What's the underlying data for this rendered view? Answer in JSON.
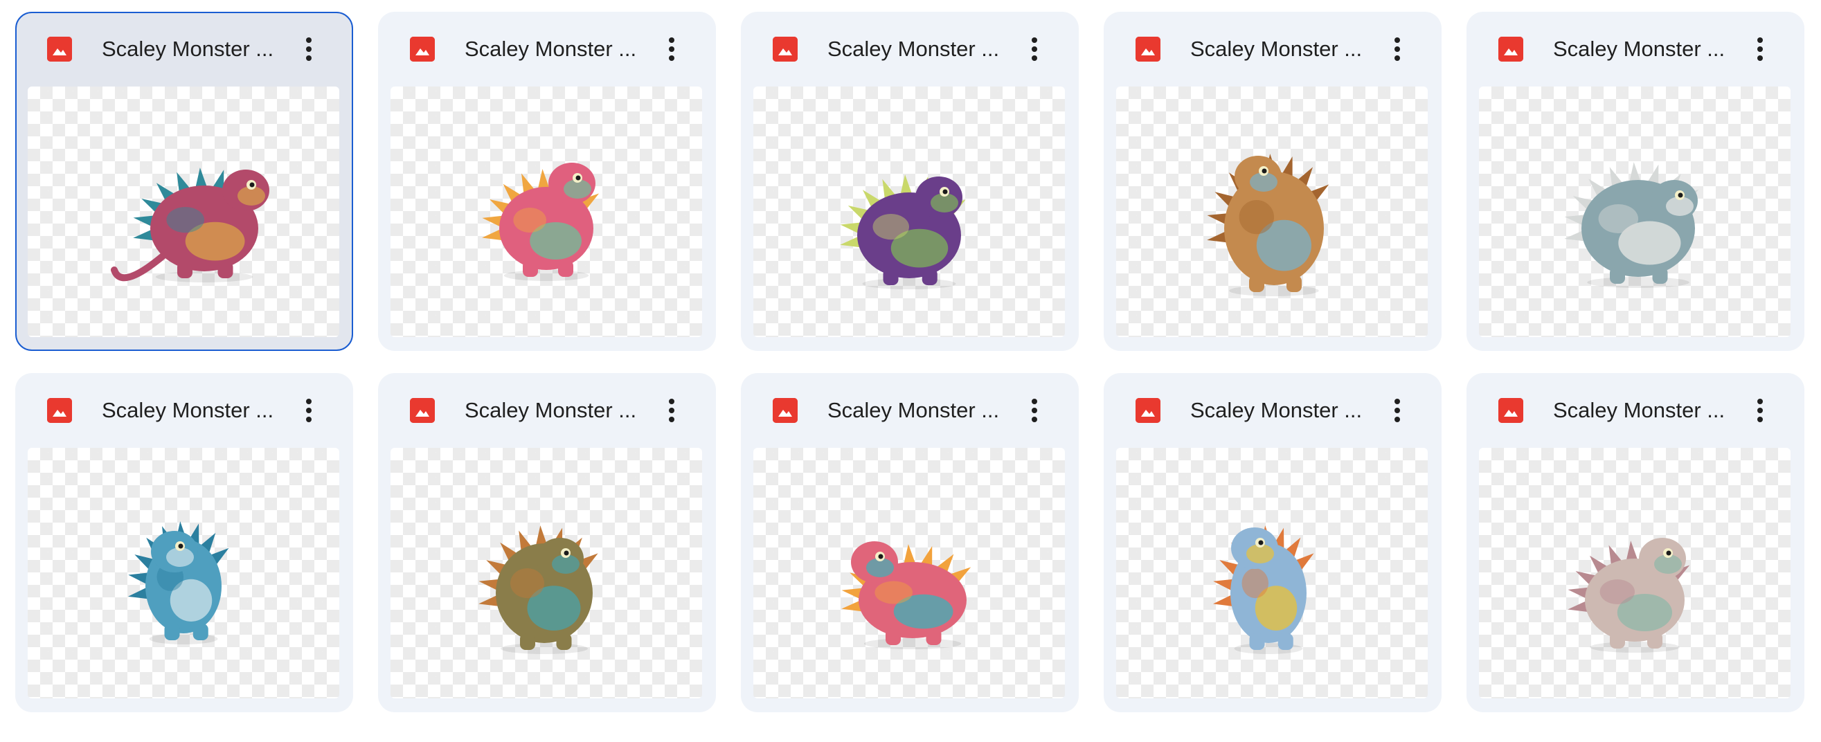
{
  "files": [
    {
      "title": "Scaley Monster ...",
      "selected": true,
      "colors": {
        "body": "#b34a6a",
        "accent": "#d9a34a",
        "spikes": "#2f8a9a"
      }
    },
    {
      "title": "Scaley Monster ...",
      "selected": false,
      "colors": {
        "body": "#e0607e",
        "accent": "#6fbf9a",
        "spikes": "#f0a640"
      }
    },
    {
      "title": "Scaley Monster ...",
      "selected": false,
      "colors": {
        "body": "#6a3e8a",
        "accent": "#7fb35a",
        "spikes": "#c9d86a"
      }
    },
    {
      "title": "Scaley Monster ...",
      "selected": false,
      "colors": {
        "body": "#c48a4e",
        "accent": "#7ab0c9",
        "spikes": "#a4652f"
      }
    },
    {
      "title": "Scaley Monster ...",
      "selected": false,
      "colors": {
        "body": "#8aa6ad",
        "accent": "#e8e8e6",
        "spikes": "#d6d9d8"
      }
    },
    {
      "title": "Scaley Monster ...",
      "selected": false,
      "colors": {
        "body": "#4f9fbf",
        "accent": "#cfe3ea",
        "spikes": "#2b7f9f"
      }
    },
    {
      "title": "Scaley Monster ...",
      "selected": false,
      "colors": {
        "body": "#8a7d4a",
        "accent": "#4aa1a8",
        "spikes": "#c27a3a"
      }
    },
    {
      "title": "Scaley Monster ...",
      "selected": false,
      "colors": {
        "body": "#e0657a",
        "accent": "#3fb0b8",
        "spikes": "#f2a23c"
      }
    },
    {
      "title": "Scaley Monster ...",
      "selected": false,
      "colors": {
        "body": "#8fb5d6",
        "accent": "#e8c23a",
        "spikes": "#e07a3c"
      }
    },
    {
      "title": "Scaley Monster ...",
      "selected": false,
      "colors": {
        "body": "#cdb9b2",
        "accent": "#8fb8a8",
        "spikes": "#b88a90"
      }
    }
  ],
  "icons": {
    "file_type": "image-file-icon",
    "menu": "more-vert-icon"
  },
  "theme": {
    "card_bg": "#eff3f9",
    "selected_bg": "#e2e6ee",
    "selected_border": "#1a5dd1",
    "file_icon": "#e9392f"
  }
}
